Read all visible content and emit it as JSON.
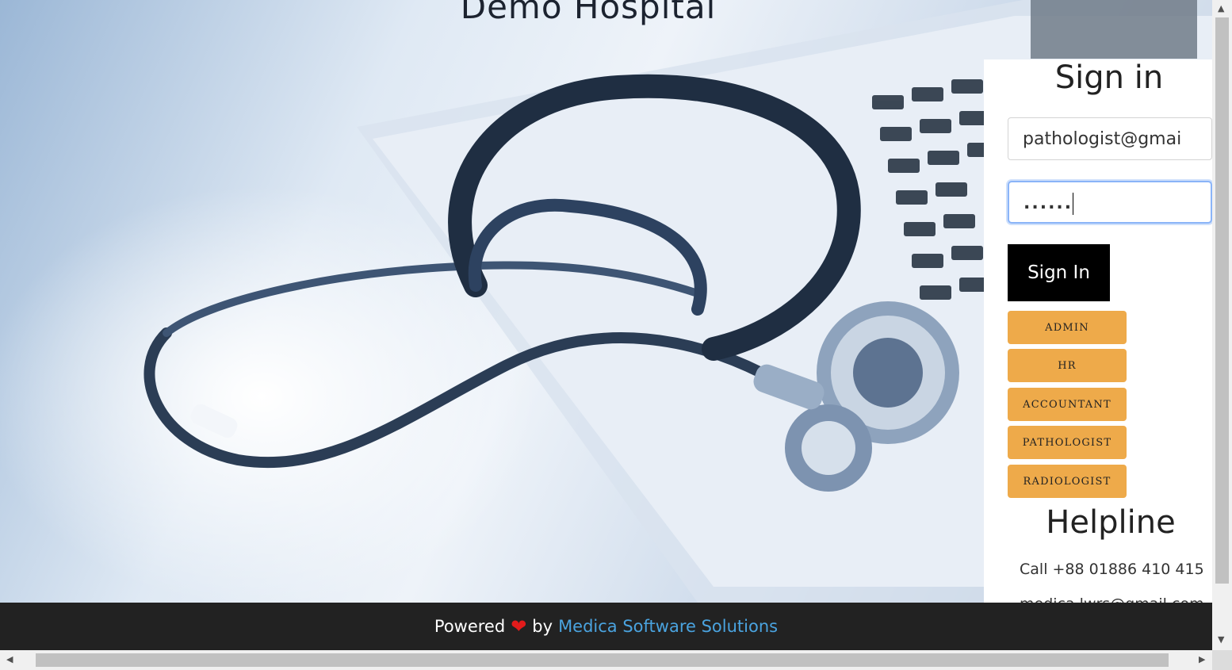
{
  "app": {
    "title": "Demo Hospital"
  },
  "signin": {
    "title": "Sign in",
    "email_value": "pathologist@gmai",
    "password_value": "......",
    "button_label": "Sign In"
  },
  "roles": [
    "ADMIN",
    "HR",
    "ACCOUNTANT",
    "PATHOLOGIST",
    "RADIOLOGIST"
  ],
  "helpline": {
    "title": "Helpline",
    "phone": "Call +88 01886 410 415",
    "email_partial": "medica.lwrs@gmail.com"
  },
  "footer": {
    "powered": "Powered",
    "by": "by",
    "company": "Medica Software Solutions"
  },
  "icons": {
    "heart": "heart-icon",
    "scroll_up": "arrow-up-icon",
    "scroll_down": "arrow-down-icon",
    "scroll_left": "arrow-left-icon",
    "scroll_right": "arrow-right-icon"
  },
  "colors": {
    "role_button": "#eeaa4a",
    "signin_button": "#000000",
    "footer_bg": "#222222",
    "footer_link": "#4aa3df",
    "heart": "#e21b1b"
  }
}
